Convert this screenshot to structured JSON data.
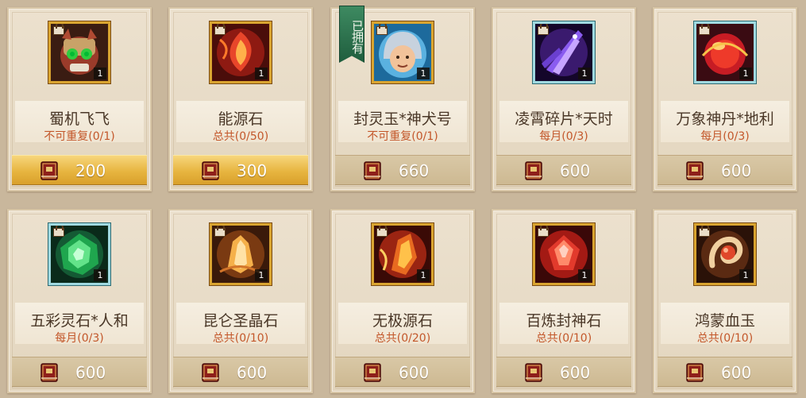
{
  "shop": {
    "owned_badge": "已拥有",
    "items": [
      {
        "name": "蜀机飞飞",
        "limit": "不可重复(0/1)",
        "price": "200",
        "count": "1",
        "highlight": true,
        "owned": false,
        "frame": "gold",
        "icon": "mech-cat-pet-icon"
      },
      {
        "name": "能源石",
        "limit": "总共(0/50)",
        "price": "300",
        "count": "1",
        "highlight": true,
        "owned": false,
        "frame": "gold",
        "icon": "energy-stone-icon"
      },
      {
        "name": "封灵玉*神犬号",
        "limit": "不可重复(0/1)",
        "price": "660",
        "count": "1",
        "highlight": false,
        "owned": true,
        "frame": "gold",
        "icon": "hooded-child-avatar-icon"
      },
      {
        "name": "凌霄碎片*天时",
        "limit": "每月(0/3)",
        "price": "600",
        "count": "1",
        "highlight": false,
        "owned": false,
        "frame": "cyan",
        "icon": "purple-crystal-shard-icon"
      },
      {
        "name": "万象神丹*地利",
        "limit": "每月(0/3)",
        "price": "600",
        "count": "1",
        "highlight": false,
        "owned": false,
        "frame": "cyan",
        "icon": "red-elixir-orb-icon"
      },
      {
        "name": "五彩灵石*人和",
        "limit": "每月(0/3)",
        "price": "600",
        "count": "1",
        "highlight": false,
        "owned": false,
        "frame": "cyan",
        "icon": "green-spirit-stone-icon"
      },
      {
        "name": "昆仑圣晶石",
        "limit": "总共(0/10)",
        "price": "600",
        "count": "1",
        "highlight": false,
        "owned": false,
        "frame": "gold",
        "icon": "kunlun-crystal-icon"
      },
      {
        "name": "无极源石",
        "limit": "总共(0/20)",
        "price": "600",
        "count": "1",
        "highlight": false,
        "owned": false,
        "frame": "gold",
        "icon": "origin-stone-icon"
      },
      {
        "name": "百炼封神石",
        "limit": "总共(0/10)",
        "price": "600",
        "count": "1",
        "highlight": false,
        "owned": false,
        "frame": "gold",
        "icon": "red-gem-stone-icon"
      },
      {
        "name": "鸿蒙血玉",
        "limit": "总共(0/10)",
        "price": "600",
        "count": "1",
        "highlight": false,
        "owned": false,
        "frame": "gold",
        "icon": "blood-jade-icon"
      }
    ]
  },
  "colors": {
    "limit_text": "#c3572a",
    "name_text": "#4a3727",
    "gold_bar": "#e7b540",
    "plain_bar": "#cdb992",
    "owned_ribbon": "#2f7a52"
  }
}
